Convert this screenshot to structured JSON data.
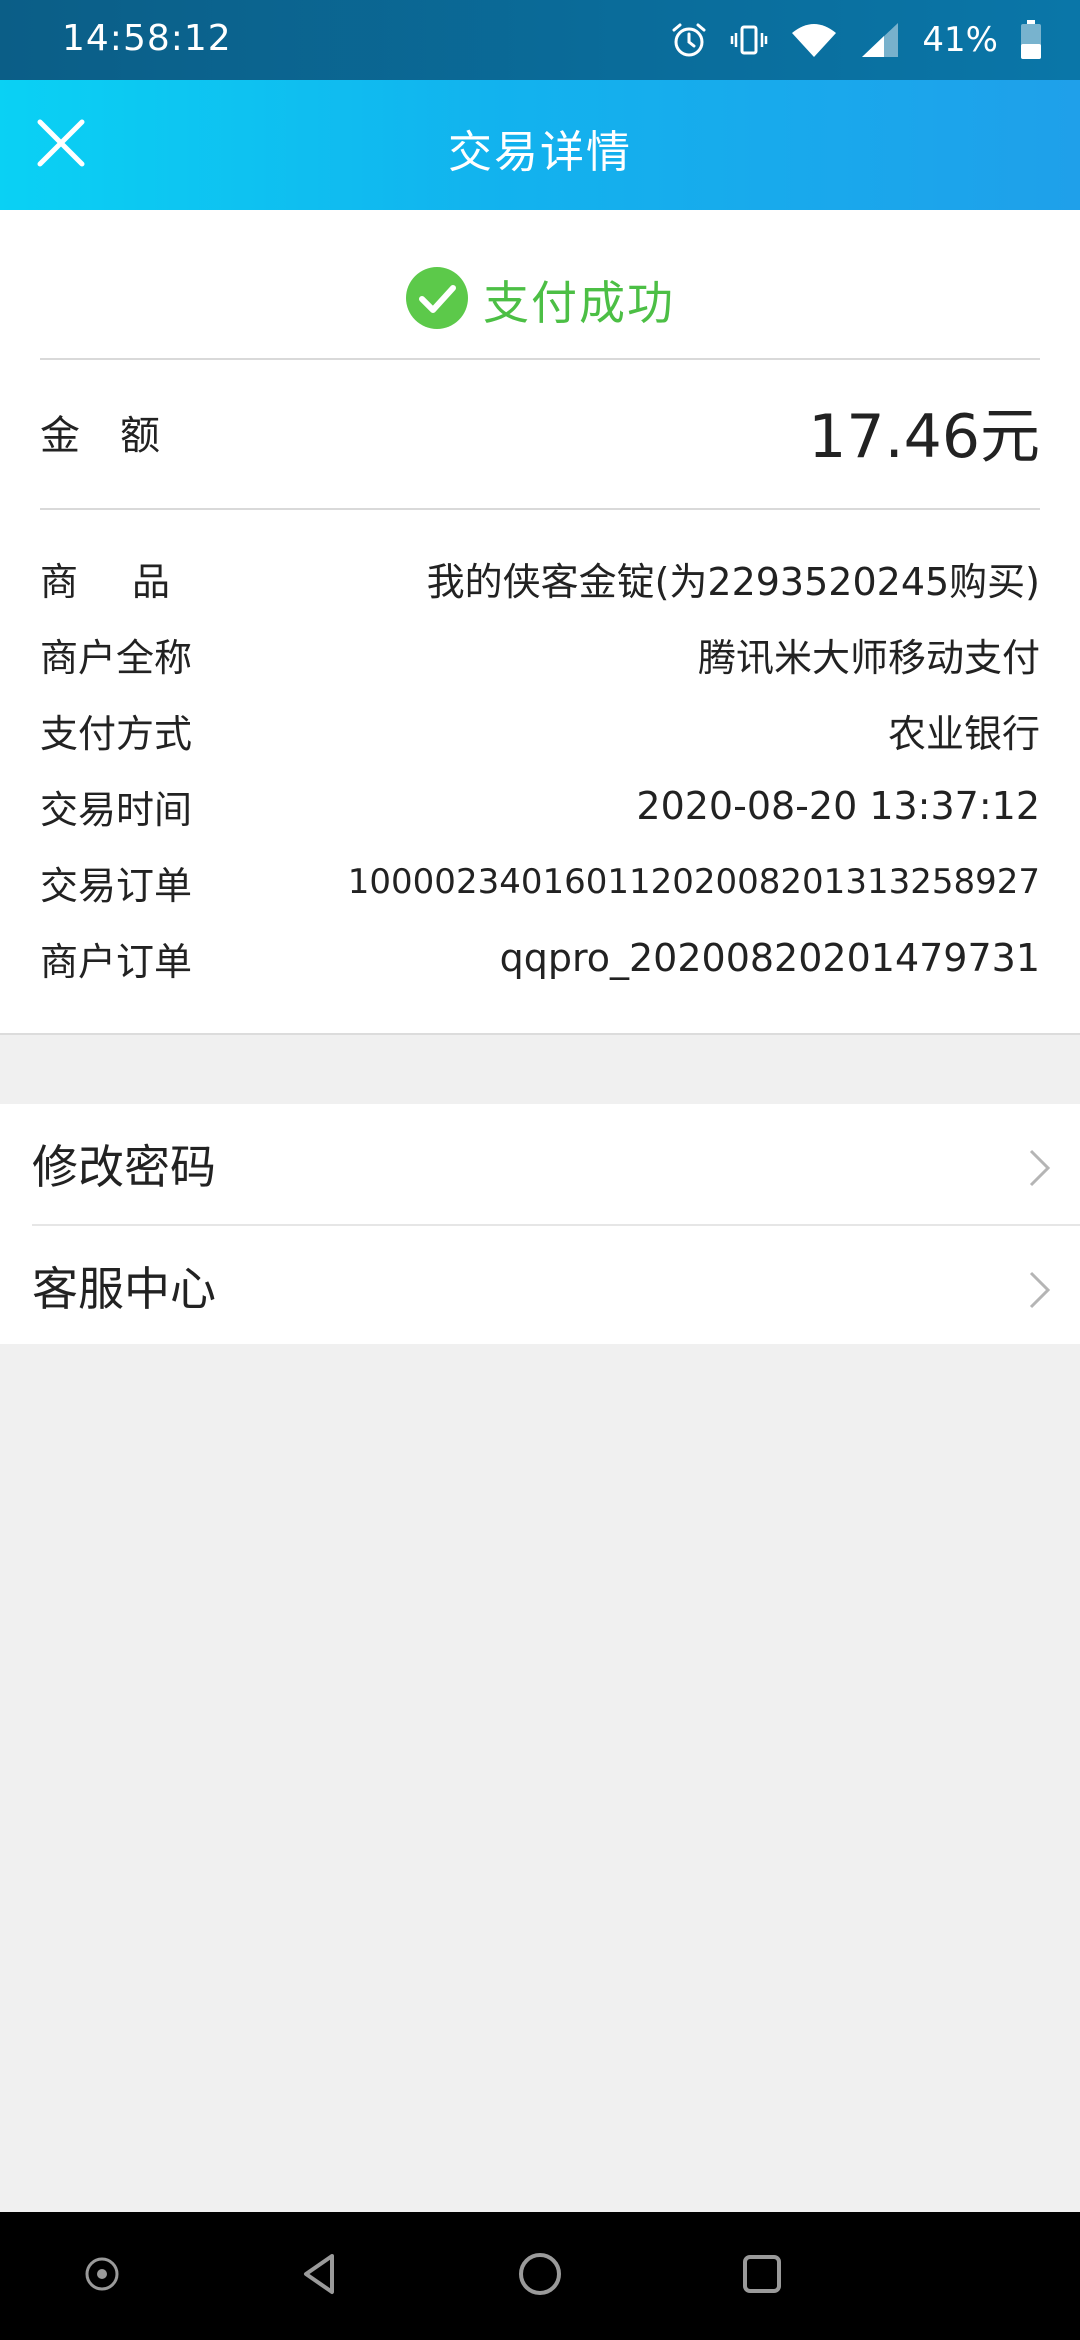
{
  "status_bar": {
    "time": "14:58:12",
    "battery_percent": "41%",
    "icons": [
      "alarm-icon",
      "vibrate-icon",
      "wifi-icon",
      "signal-icon",
      "battery-icon"
    ]
  },
  "header": {
    "title": "交易详情",
    "close_icon": "close-icon"
  },
  "payment": {
    "status_text": "支付成功",
    "status_icon": "check-circle-icon",
    "status_color": "#4cbf45",
    "amount_label": "金额",
    "amount_value": "17.46元"
  },
  "details": [
    {
      "label": "商品",
      "value": "我的侠客金锭(为2293520245购买)"
    },
    {
      "label": "商户全称",
      "value": "腾讯米大师移动支付"
    },
    {
      "label": "支付方式",
      "value": "农业银行"
    },
    {
      "label": "交易时间",
      "value": "2020-08-20 13:37:12"
    },
    {
      "label": "交易订单",
      "value": "1000023401601120200820131325​8927"
    },
    {
      "label": "商户订单",
      "value": "qqpro_20200820201479731"
    }
  ],
  "menu": [
    {
      "label": "修改密码",
      "icon": "chevron-right-icon"
    },
    {
      "label": "客服中心",
      "icon": "chevron-right-icon"
    }
  ],
  "nav_bar": {
    "buttons": [
      "assistant-icon",
      "back-icon",
      "home-icon",
      "recents-icon"
    ]
  },
  "colors": {
    "app_bar_start": "#0ad1f4",
    "app_bar_end": "#1fa0ea",
    "status_bar": "#0b6a98",
    "success_green": "#4cbf45"
  }
}
